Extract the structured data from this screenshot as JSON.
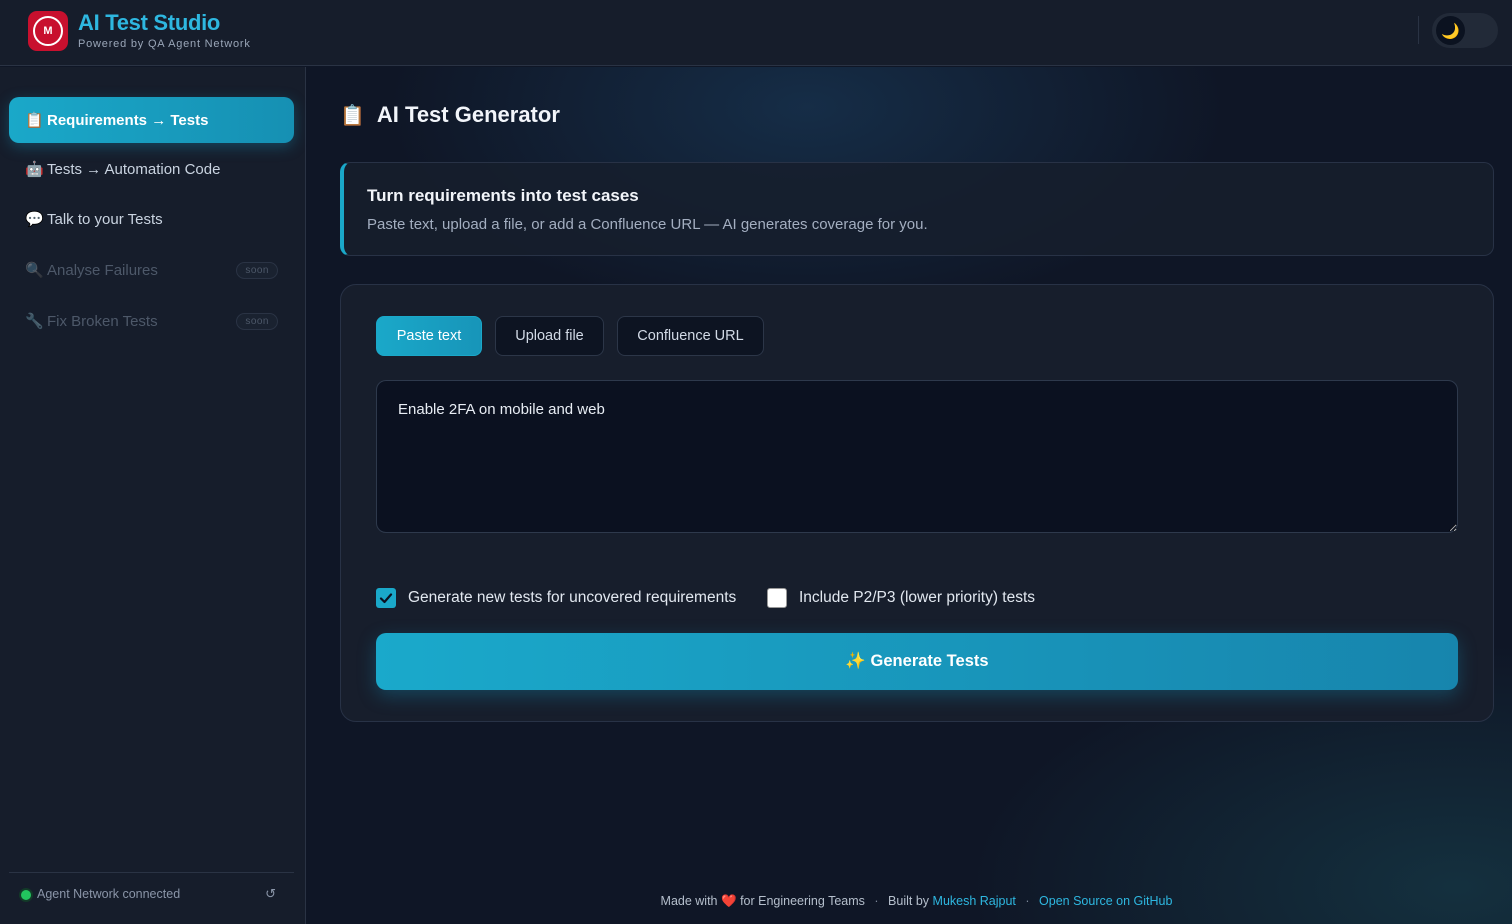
{
  "header": {
    "title": "AI Test Studio",
    "subtitle": "Powered by QA Agent Network",
    "logo_text": "M",
    "theme_icon": "🌙"
  },
  "sidebar": {
    "items": [
      {
        "icon": "📋",
        "label": "Requirements → Tests",
        "active": true
      },
      {
        "icon": "🤖",
        "label": "Tests → Automation Code"
      },
      {
        "icon": "💬",
        "label": "Talk to your Tests"
      },
      {
        "icon": "🔍",
        "label": "Analyse Failures",
        "badge": "soon"
      },
      {
        "icon": "🔧",
        "label": "Fix Broken Tests",
        "badge": "soon"
      }
    ],
    "status": "Agent Network connected",
    "refresh_icon": "↺"
  },
  "main": {
    "title_icon": "📋",
    "title": "AI Test Generator",
    "info": {
      "title": "Turn requirements into test cases",
      "subtitle": "Paste text, upload a file, or add a Confluence URL — AI generates coverage for you."
    },
    "tabs": [
      {
        "label": "Paste text",
        "active": true
      },
      {
        "label": "Upload file"
      },
      {
        "label": "Confluence URL"
      }
    ],
    "textarea_value": "Enable 2FA on mobile and web",
    "options": [
      {
        "label": "Generate new tests for uncovered requirements",
        "checked": true
      },
      {
        "label": "Include P2/P3 (lower priority) tests",
        "checked": false
      }
    ],
    "generate_button": "✨ Generate Tests"
  },
  "footer": {
    "made_with": "Made with",
    "heart": "❤️",
    "for_teams": "for Engineering Teams",
    "built_by": "Built by",
    "author": "Mukesh Rajput",
    "github": "Open Source on GitHub",
    "separator": "·"
  },
  "colors": {
    "accent": "#1aa8c9",
    "brand": "#2eb7e0",
    "logo": "#c8102e",
    "status_ok": "#22c55e"
  }
}
